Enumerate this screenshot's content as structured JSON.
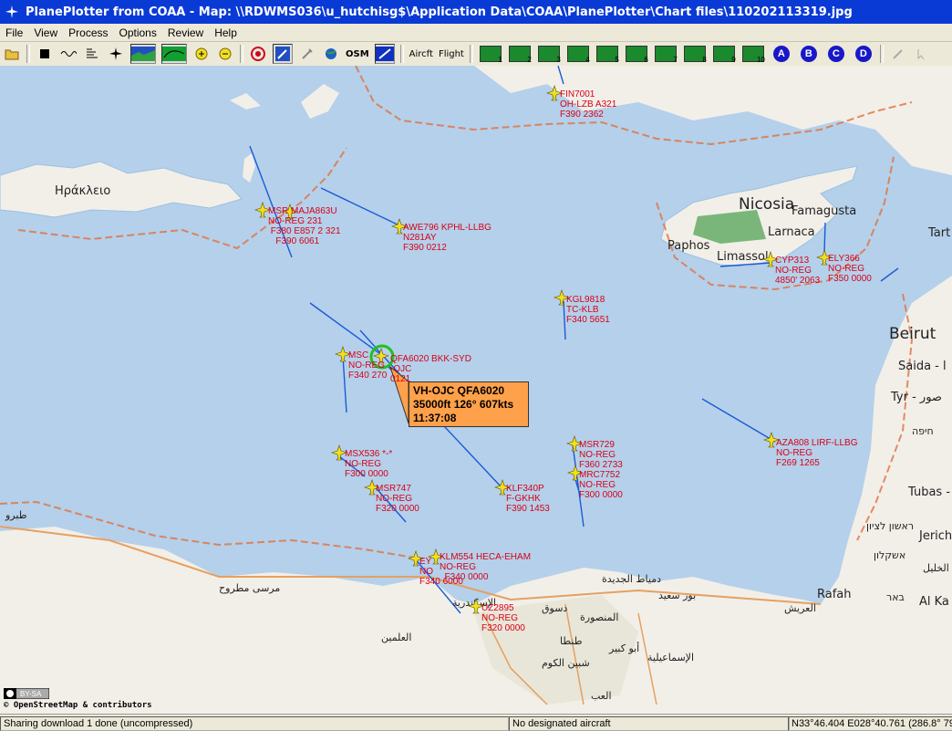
{
  "window": {
    "title": "PlanePlotter from COAA - Map: \\\\RDWMS036\\u_hutchisg$\\Application Data\\COAA\\PlanePlotter\\Chart files\\110202113319.jpg"
  },
  "menu": [
    "File",
    "View",
    "Process",
    "Options",
    "Review",
    "Help"
  ],
  "toolbar": {
    "osm": "OSM",
    "aircft": "Aircft",
    "flight": "Flight",
    "layers": [
      "1",
      "2",
      "3",
      "4",
      "5",
      "6",
      "7",
      "8",
      "9",
      "10"
    ],
    "letters": [
      "A",
      "B",
      "C",
      "D"
    ]
  },
  "map": {
    "places": {
      "heraklion": "Ηράκλειο",
      "nicosia": "Nicosia",
      "famagusta": "Famagusta",
      "paphos": "Paphos",
      "larnaca": "Larnaca",
      "limassol": "Limassol",
      "beirut": "Beirut",
      "saida": "Saida - ا",
      "tyr": "Tyr - صور",
      "haifa": "חיפה",
      "tart": "Tart",
      "tubas": "Tubas -",
      "rishon": "ראשון לציון",
      "ashkelon": "אשקלון",
      "jerich": "Jerich",
      "alkhalil": "الخليل",
      "rafah": "Rafah",
      "beer": "באר",
      "alka": "Al Ka",
      "marsa": "مرسى مطروح",
      "alalamein": "العلمين",
      "damietta": "دمياط الجديدة",
      "portsaid": "بور سعيد",
      "arish": "العريش",
      "desouk": "دسوق",
      "mansoura": "المنصورة",
      "tanta": "طنطا",
      "abukabir": "أبو كبير",
      "ismailia": "الإسماعيلية",
      "shibin": "شبين الكوم",
      "alex": "الإسكندرية",
      "tobruk": "طبرو",
      "elgiza": "العب"
    },
    "aircraft": [
      {
        "id": "fin7001",
        "text": "FIN7001\nOH-LZB A321\nF390 2362"
      },
      {
        "id": "awe796",
        "text": "AWE796 KPHL-LLBG\nN281AY\nF390 0212"
      },
      {
        "id": "msr-cluster",
        "text": "MSR MAJA863U\nNO-REG 231\n F380 E857 2 321\n   F390 6061"
      },
      {
        "id": "kgl9818",
        "text": "KGL9818\nTC-KLB\nF340 5651"
      },
      {
        "id": "cyp313",
        "text": "CYP313\nNO-REG\n4850' 2063"
      },
      {
        "id": "ely366",
        "text": "ELY366\nNO-REG\nF350 0000"
      },
      {
        "id": "qfa6020",
        "text": "QFA6020 BKK-SYD\n-OJC\n0121"
      },
      {
        "id": "msc",
        "text": "MSC\nNO-REG\nF340 270"
      },
      {
        "id": "msx536",
        "text": "MSX536 *-*\nNO-REG\nF300 0000"
      },
      {
        "id": "msr747",
        "text": "MSR747\nNO-REG\nF320 0000"
      },
      {
        "id": "klf340p",
        "text": "KLF340P\nF-GKHK\nF390 1453"
      },
      {
        "id": "msr729",
        "text": "MSR729\nNO-REG\nF360 2733\n"
      },
      {
        "id": "mrc7752",
        "text": "MRC7752\nNO-REG\nF300 0000"
      },
      {
        "id": "aza808",
        "text": "AZA808 LIRF-LLBG\nNO-REG\nF269 1265"
      },
      {
        "id": "klm554",
        "text": "KLM554 HECA-EHAM\nNO-REG\n  F340 0000"
      },
      {
        "id": "uz2895",
        "text": "UZ2895\nNO-REG\nF320 0000"
      },
      {
        "id": "sw-cluster",
        "text": "EY\nNO\nF340 6000"
      }
    ],
    "callout": {
      "line1": "VH-OJC QFA6020",
      "line2": "35000ft 126° 607kts",
      "line3": "11:37:08"
    },
    "attribution": "© OpenStreetMap & contributors",
    "license": "BY-SA"
  },
  "status": {
    "left": "Sharing download 1 done (uncompressed)",
    "middle": "No designated aircraft",
    "right": "N33°46.404 E028°40.761 (286.8° 79"
  },
  "colors": {
    "sea": "#b5d0ea",
    "land": "#f2efe9",
    "aircraft": "#f0e020",
    "label": "#d80018",
    "track": "#1a5ad8",
    "callout": "#ffa14a"
  }
}
